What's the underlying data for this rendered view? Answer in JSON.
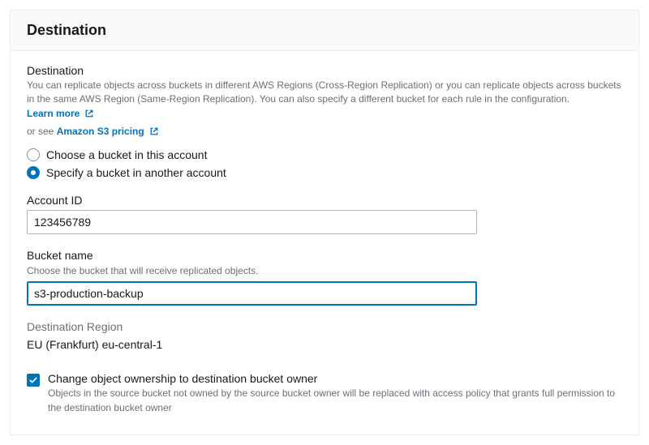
{
  "panel": {
    "title": "Destination"
  },
  "destination": {
    "label": "Destination",
    "description": "You can replicate objects across buckets in different AWS Regions (Cross-Region Replication) or you can replicate objects across buckets in the same AWS Region (Same-Region Replication). You can also specify a different bucket for each rule in the configuration.",
    "learn_more": "Learn more",
    "or_see_prefix": "or see",
    "pricing_link": "Amazon S3 pricing"
  },
  "radios": {
    "choose_this_account": "Choose a bucket in this account",
    "specify_other_account": "Specify a bucket in another account"
  },
  "account_id": {
    "label": "Account ID",
    "value": "123456789"
  },
  "bucket_name": {
    "label": "Bucket name",
    "hint": "Choose the bucket that will receive replicated objects.",
    "value": "s3-production-backup"
  },
  "region": {
    "label": "Destination Region",
    "value": "EU (Frankfurt) eu-central-1"
  },
  "ownership": {
    "label": "Change object ownership to destination bucket owner",
    "description": "Objects in the source bucket not owned by the source bucket owner will be replaced with access policy that grants full permission to the destination bucket owner"
  }
}
